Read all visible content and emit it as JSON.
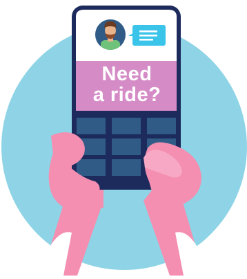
{
  "illustration": {
    "headline_line1": "Need",
    "headline_line2": "a ride?",
    "icons": [
      "driver-avatar-icon",
      "chat-bubble-icon"
    ],
    "colors": {
      "circle": "#8ed4e6",
      "phone_frame": "#1d2a5c",
      "banner": "#d58cc6",
      "keypad": "#2f5b86",
      "hand": "#f48fb1",
      "chat_bubble": "#3ac4ea",
      "avatar_bg": "#2f5b86"
    }
  }
}
